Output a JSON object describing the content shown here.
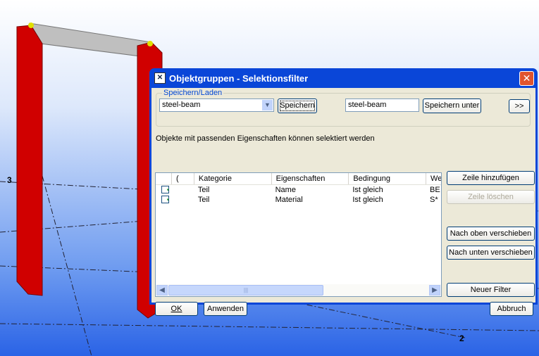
{
  "viewport": {
    "axis_labels": [
      "3",
      "2"
    ],
    "column_color": "#cc0000"
  },
  "dialog": {
    "title": "Objektgruppen - Selektionsfilter",
    "close_label": "✕",
    "group_label": "Speichern/Laden",
    "filter_select": "steel-beam",
    "save_label": "Speichern",
    "save_as_input": "steel-beam",
    "save_as_label": "Speichern unter",
    "expand_label": ">>",
    "info_text": "Objekte mit passenden Eigenschaften können selektiert werden",
    "columns": [
      "(",
      "Kategorie",
      "Eigenschaften",
      "Bedingung",
      "We"
    ],
    "rows": [
      {
        "checked": true,
        "kategorie": "Teil",
        "eigenschaft": "Name",
        "bedingung": "Ist gleich",
        "wert": "BE"
      },
      {
        "checked": true,
        "kategorie": "Teil",
        "eigenschaft": "Material",
        "bedingung": "Ist gleich",
        "wert": "S*"
      }
    ],
    "side_buttons": {
      "add_row": "Zeile hinzufügen",
      "delete_row": "Zeile löschen",
      "move_up": "Nach oben verschieben",
      "move_down": "Nach unten verschieben",
      "new_filter": "Neuer Filter"
    },
    "ok_label": "OK",
    "apply_label": "Anwenden",
    "cancel_label": "Abbruch"
  }
}
